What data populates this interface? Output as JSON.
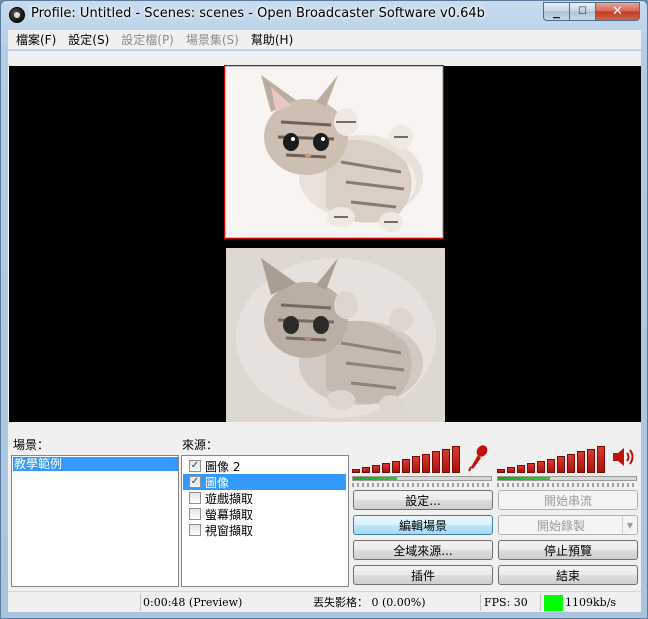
{
  "window": {
    "title": "Profile: Untitled - Scenes: scenes - Open Broadcaster Software v0.64b",
    "controls": {
      "minimize": "▁",
      "maximize": "☐",
      "close": "✕"
    }
  },
  "menu": {
    "items": [
      {
        "label": "檔案(F)",
        "enabled": true
      },
      {
        "label": "設定(S)",
        "enabled": true
      },
      {
        "label": "設定檔(P)",
        "enabled": false
      },
      {
        "label": "場景集(S)",
        "enabled": false
      },
      {
        "label": "幫助(H)",
        "enabled": true
      }
    ]
  },
  "preview": {
    "selected_source": "圖像"
  },
  "scenes": {
    "label": "場景：",
    "items": [
      {
        "label": "教學範例",
        "selected": true
      }
    ]
  },
  "sources": {
    "label": "來源：",
    "items": [
      {
        "label": "圖像 2",
        "checked": true,
        "selected": false
      },
      {
        "label": "圖像",
        "checked": true,
        "selected": true
      },
      {
        "label": "遊戲擷取",
        "checked": false,
        "selected": false
      },
      {
        "label": "螢幕擷取",
        "checked": false,
        "selected": false
      },
      {
        "label": "視窗擷取",
        "checked": false,
        "selected": false
      }
    ]
  },
  "audio": {
    "mic": {
      "icon": "microphone-icon",
      "level": 0.32,
      "color": "#c0130d"
    },
    "desktop": {
      "icon": "speaker-icon",
      "level": 0.38,
      "color": "#c0130d"
    }
  },
  "buttons": {
    "settings": "設定...",
    "start_stream": "開始串流",
    "edit_scene": "編輯場景",
    "start_record": "開始錄製",
    "global_sources": "全域來源...",
    "stop_preview": "停止預覽",
    "plugins": "插件",
    "exit": "結束"
  },
  "status": {
    "time": "0:00:48 (Preview)",
    "dropped_frames": "丟失影格： 0 (0.00%)",
    "fps": "FPS: 30",
    "bitrate": "1109kb/s",
    "bitrate_indicator_color": "#00ff00"
  }
}
